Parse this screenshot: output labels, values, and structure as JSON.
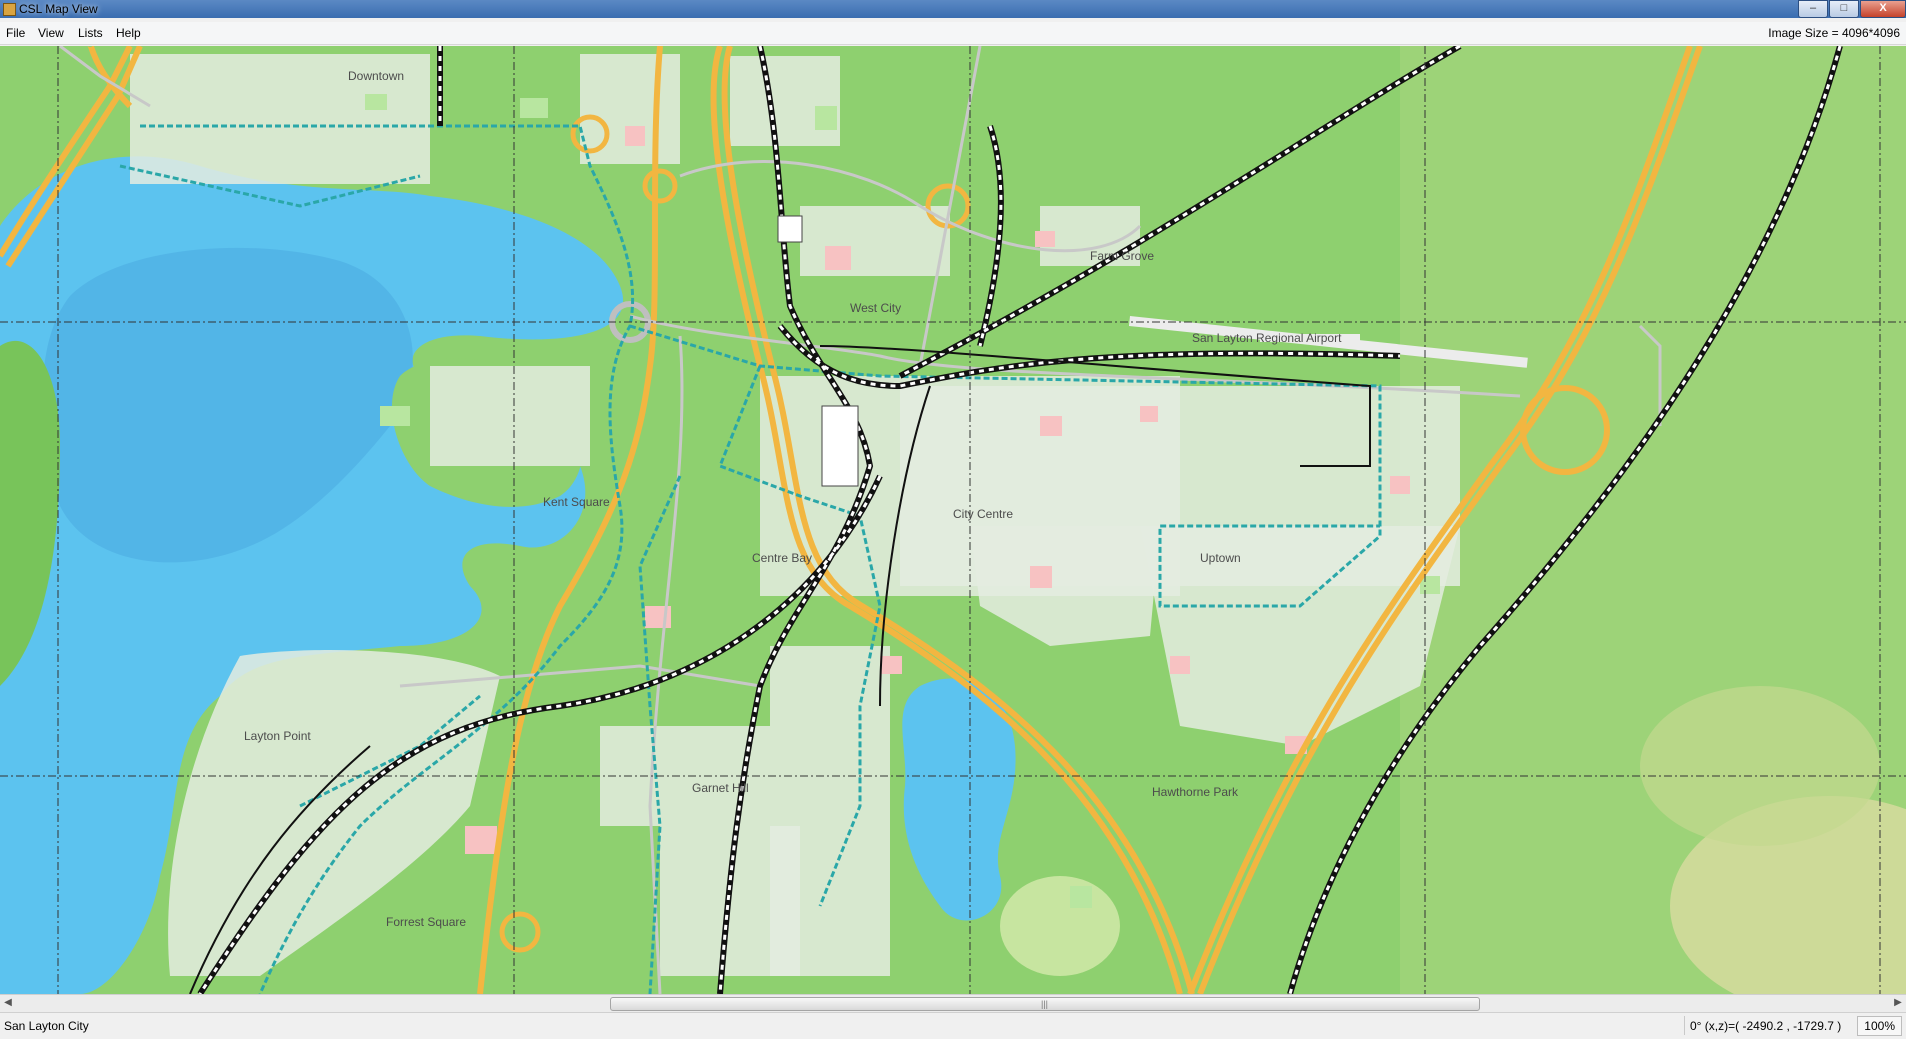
{
  "window": {
    "title": "CSL Map View",
    "buttons": {
      "minimize": "–",
      "maximize": "□",
      "close": "X"
    }
  },
  "menu": {
    "items": [
      "File",
      "View",
      "Lists",
      "Help"
    ],
    "image_size": "Image Size = 4096*4096"
  },
  "map": {
    "districts": [
      "Downtown",
      "West City",
      "Farm Grove",
      "San Layton Regional Airport",
      "Kent Square",
      "City Centre",
      "Centre Bay",
      "Uptown",
      "Layton Point",
      "Garnet Hill",
      "Hawthorne Park",
      "Forrest Square"
    ],
    "colors": {
      "land": "#8ed06f",
      "water": "#5cc3ef",
      "deep_water": "#4aa9e0",
      "highway": "#f2b641",
      "rail": "#111111",
      "transit": "#2aa7a8",
      "building": "#e8efe4",
      "park": "#b8e6a0",
      "commercial": "#f7c2c2",
      "grid": "#333333"
    }
  },
  "status": {
    "city": "San Layton City",
    "coords": "0° (x,z)=( -2490.2 , -1729.7 )",
    "zoom": "100%"
  }
}
